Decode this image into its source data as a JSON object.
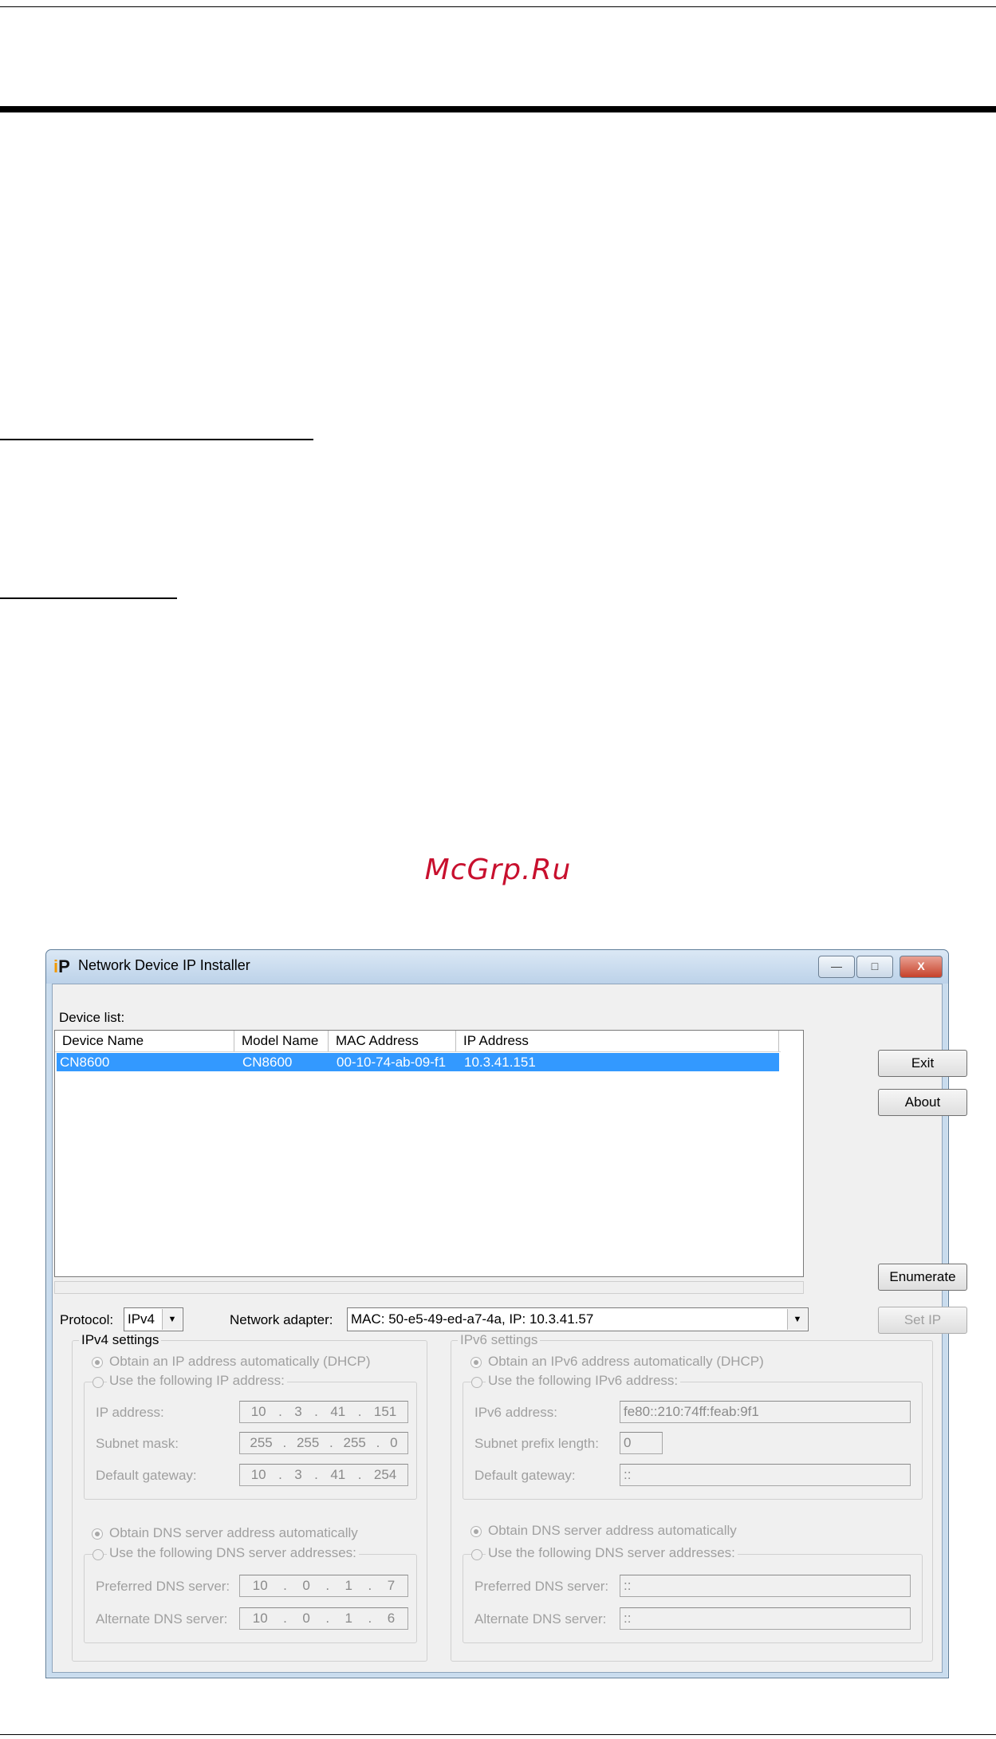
{
  "watermark": "McGrp.Ru",
  "window": {
    "title": "Network Device IP Installer",
    "icon": "ip-installer-app-icon",
    "min_glyph": "—",
    "max_glyph": "□",
    "close_glyph": "X"
  },
  "device_list": {
    "label": "Device list:",
    "columns": [
      "Device Name",
      "Model Name",
      "MAC Address",
      "IP Address"
    ],
    "rows": [
      {
        "device_name": "CN8600",
        "model_name": "CN8600",
        "mac": "00-10-74-ab-09-f1",
        "ip": "10.3.41.151"
      }
    ]
  },
  "buttons": {
    "exit": "Exit",
    "about": "About",
    "enumerate": "Enumerate",
    "set_ip": "Set IP"
  },
  "protocol": {
    "label": "Protocol:",
    "value": "IPv4"
  },
  "network_adapter": {
    "label": "Network adapter:",
    "value": "MAC: 50-e5-49-ed-a7-4a,  IP: 10.3.41.57"
  },
  "ipv4": {
    "legend": "IPv4 settings",
    "obtain_auto": "Obtain an IP address automatically (DHCP)",
    "use_following": "Use the following IP address:",
    "ip_label": "IP address:",
    "ip": [
      "10",
      "3",
      "41",
      "151"
    ],
    "mask_label": "Subnet mask:",
    "mask": [
      "255",
      "255",
      "255",
      "0"
    ],
    "gateway_label": "Default gateway:",
    "gateway": [
      "10",
      "3",
      "41",
      "254"
    ],
    "dns_auto": "Obtain DNS server address automatically",
    "dns_use": "Use the following DNS server addresses:",
    "pref_label": "Preferred DNS server:",
    "pref": [
      "10",
      "0",
      "1",
      "7"
    ],
    "alt_label": "Alternate DNS server:",
    "alt": [
      "10",
      "0",
      "1",
      "6"
    ]
  },
  "ipv6": {
    "legend": "IPv6 settings",
    "obtain_auto": "Obtain an IPv6 address automatically (DHCP)",
    "use_following": "Use the following IPv6 address:",
    "addr_label": "IPv6 address:",
    "addr": "fe80::210:74ff:feab:9f1",
    "prefix_label": "Subnet prefix length:",
    "prefix": "0",
    "gateway_label": "Default gateway:",
    "gateway": "::",
    "dns_auto": "Obtain DNS server address automatically",
    "dns_use": "Use the following DNS server addresses:",
    "pref_label": "Preferred DNS server:",
    "pref": "::",
    "alt_label": "Alternate DNS server:",
    "alt": "::"
  }
}
